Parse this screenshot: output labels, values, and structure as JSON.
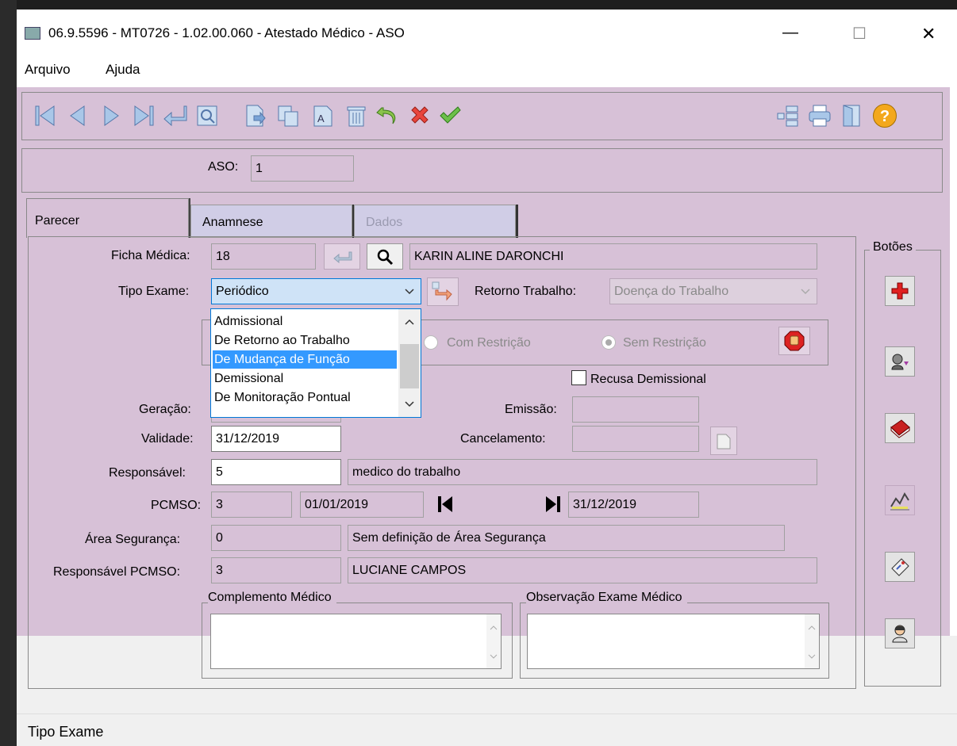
{
  "window": {
    "title": "06.9.5596 - MT0726 - 1.02.00.060 - Atestado Médico - ASO",
    "min_glyph": "—",
    "max_glyph": "☐",
    "close_glyph": "✕"
  },
  "menu": {
    "items": [
      "Arquivo",
      "Ajuda"
    ]
  },
  "toolbar": {
    "nav_icons": [
      "first-record-icon",
      "previous-record-icon",
      "next-record-icon",
      "last-record-icon",
      "return-icon",
      "preview-icon"
    ],
    "edit_icons": [
      "new-record-icon",
      "copy-record-icon",
      "edit-record-icon",
      "delete-record-icon",
      "undo-icon",
      "cancel-icon",
      "confirm-icon"
    ],
    "right_icons": [
      "tree-icon",
      "print-icon",
      "exit-door-icon",
      "help-icon"
    ],
    "help_glyph": "?"
  },
  "header": {
    "aso_label": "ASO:",
    "aso_value": "1"
  },
  "tabs": [
    {
      "label": "Parecer",
      "active": true
    },
    {
      "label": "Anamnese",
      "active": false
    },
    {
      "label": "Dados",
      "active": false,
      "disabled": true
    }
  ],
  "form": {
    "ficha_label": "Ficha Médica:",
    "ficha_value": "18",
    "ficha_name": "KARIN ALINE DARONCHI",
    "tipo_label": "Tipo Exame:",
    "tipo_value": "Periódico",
    "retorno_label": "Retorno Trabalho:",
    "retorno_value": "Doença do Trabalho",
    "com_restricao": "Com Restrição",
    "sem_restricao": "Sem Restrição",
    "recusa_label": "Recusa Demissional",
    "geracao_label": "Geração:",
    "emissao_label": "Emissão:",
    "validade_label": "Validade:",
    "validade_value": "31/12/2019",
    "cancelamento_label": "Cancelamento:",
    "responsavel_label": "Responsável:",
    "responsavel_value": "5",
    "responsavel_name": "medico do trabalho",
    "pcmso_label": "PCMSO:",
    "pcmso_value": "3",
    "pcmso_start": "01/01/2019",
    "pcmso_end": "31/12/2019",
    "area_label": "Área Segurança:",
    "area_value": "0",
    "area_name": "Sem definição de Área Segurança",
    "resp_pcmso_label": "Responsável PCMSO:",
    "resp_pcmso_value": "3",
    "resp_pcmso_name": "LUCIANE CAMPOS",
    "complemento_label": "Complemento Médico",
    "observacao_label": "Observação Exame Médico"
  },
  "dropdown": {
    "options": [
      "Admissional",
      "De Retorno ao Trabalho",
      "De Mudança de Função",
      "Demissional",
      "De Monitoração Pontual"
    ],
    "highlighted_index": 2,
    "highlight_color": "#3399ff"
  },
  "botoes": {
    "title": "Botões",
    "icons": [
      "add-red-cross-icon",
      "person-arrow-icon",
      "book-icon",
      "chart-icon",
      "document-edit-icon",
      "doctor-icon"
    ]
  },
  "status": {
    "text": "Tipo Exame"
  },
  "colors": {
    "form_bg": "#d7c1d7",
    "field_bg": "#d7c1d7",
    "accent": "#3399ff"
  }
}
